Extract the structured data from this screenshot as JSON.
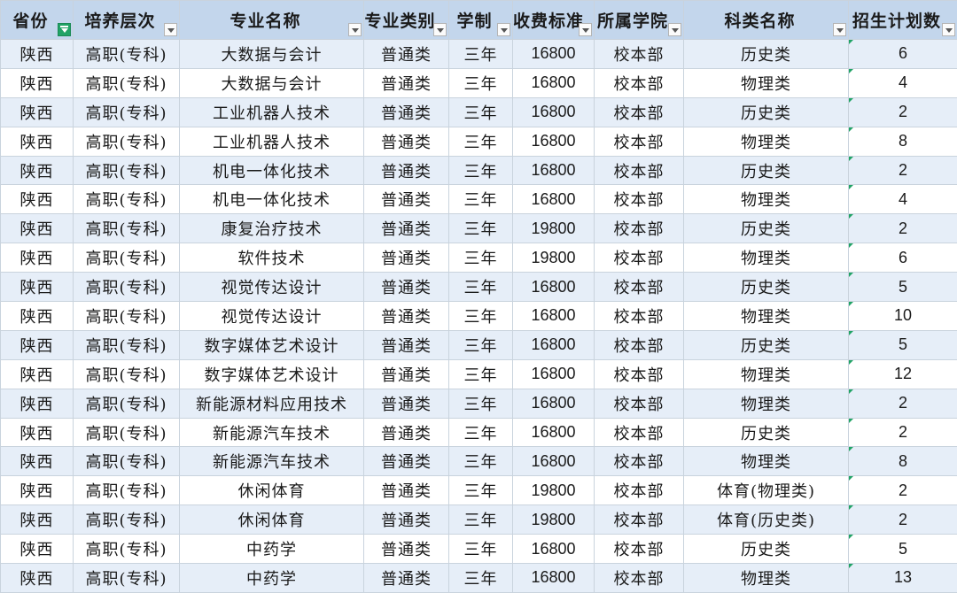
{
  "headers": [
    {
      "label": "省份",
      "filter": "active"
    },
    {
      "label": "培养层次",
      "filter": "dropdown"
    },
    {
      "label": "专业名称",
      "filter": "dropdown"
    },
    {
      "label": "专业类别",
      "filter": "dropdown"
    },
    {
      "label": "学制",
      "filter": "dropdown"
    },
    {
      "label": "收费标准",
      "filter": "dropdown"
    },
    {
      "label": "所属学院",
      "filter": "dropdown"
    },
    {
      "label": "科类名称",
      "filter": "dropdown"
    },
    {
      "label": "招生计划数",
      "filter": "dropdown"
    }
  ],
  "rows": [
    [
      "陕西",
      "高职(专科)",
      "大数据与会计",
      "普通类",
      "三年",
      "16800",
      "校本部",
      "历史类",
      "6"
    ],
    [
      "陕西",
      "高职(专科)",
      "大数据与会计",
      "普通类",
      "三年",
      "16800",
      "校本部",
      "物理类",
      "4"
    ],
    [
      "陕西",
      "高职(专科)",
      "工业机器人技术",
      "普通类",
      "三年",
      "16800",
      "校本部",
      "历史类",
      "2"
    ],
    [
      "陕西",
      "高职(专科)",
      "工业机器人技术",
      "普通类",
      "三年",
      "16800",
      "校本部",
      "物理类",
      "8"
    ],
    [
      "陕西",
      "高职(专科)",
      "机电一体化技术",
      "普通类",
      "三年",
      "16800",
      "校本部",
      "历史类",
      "2"
    ],
    [
      "陕西",
      "高职(专科)",
      "机电一体化技术",
      "普通类",
      "三年",
      "16800",
      "校本部",
      "物理类",
      "4"
    ],
    [
      "陕西",
      "高职(专科)",
      "康复治疗技术",
      "普通类",
      "三年",
      "19800",
      "校本部",
      "历史类",
      "2"
    ],
    [
      "陕西",
      "高职(专科)",
      "软件技术",
      "普通类",
      "三年",
      "19800",
      "校本部",
      "物理类",
      "6"
    ],
    [
      "陕西",
      "高职(专科)",
      "视觉传达设计",
      "普通类",
      "三年",
      "16800",
      "校本部",
      "历史类",
      "5"
    ],
    [
      "陕西",
      "高职(专科)",
      "视觉传达设计",
      "普通类",
      "三年",
      "16800",
      "校本部",
      "物理类",
      "10"
    ],
    [
      "陕西",
      "高职(专科)",
      "数字媒体艺术设计",
      "普通类",
      "三年",
      "16800",
      "校本部",
      "历史类",
      "5"
    ],
    [
      "陕西",
      "高职(专科)",
      "数字媒体艺术设计",
      "普通类",
      "三年",
      "16800",
      "校本部",
      "物理类",
      "12"
    ],
    [
      "陕西",
      "高职(专科)",
      "新能源材料应用技术",
      "普通类",
      "三年",
      "16800",
      "校本部",
      "物理类",
      "2"
    ],
    [
      "陕西",
      "高职(专科)",
      "新能源汽车技术",
      "普通类",
      "三年",
      "16800",
      "校本部",
      "历史类",
      "2"
    ],
    [
      "陕西",
      "高职(专科)",
      "新能源汽车技术",
      "普通类",
      "三年",
      "16800",
      "校本部",
      "物理类",
      "8"
    ],
    [
      "陕西",
      "高职(专科)",
      "休闲体育",
      "普通类",
      "三年",
      "19800",
      "校本部",
      "体育(物理类)",
      "2"
    ],
    [
      "陕西",
      "高职(专科)",
      "休闲体育",
      "普通类",
      "三年",
      "19800",
      "校本部",
      "体育(历史类)",
      "2"
    ],
    [
      "陕西",
      "高职(专科)",
      "中药学",
      "普通类",
      "三年",
      "16800",
      "校本部",
      "历史类",
      "5"
    ],
    [
      "陕西",
      "高职(专科)",
      "中药学",
      "普通类",
      "三年",
      "16800",
      "校本部",
      "物理类",
      "13"
    ]
  ],
  "colors": {
    "header_bg": "#c3d6ec",
    "band_bg": "#e6eef8",
    "filter_active": "#21a366",
    "grid_line": "#c9d3dd"
  }
}
